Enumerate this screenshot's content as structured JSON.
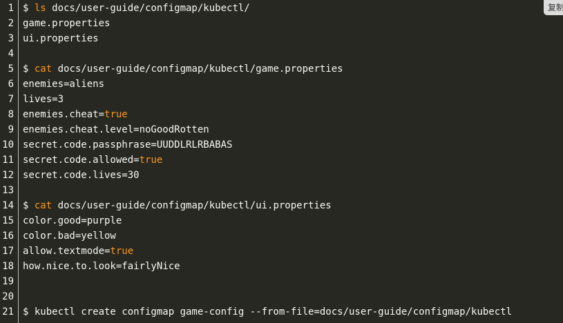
{
  "copy_button": {
    "label": "复制"
  },
  "lines": [
    {
      "n": "1",
      "segments": [
        {
          "text": "$ "
        },
        {
          "text": "ls",
          "kw": true
        },
        {
          "text": " docs/user-guide/configmap/kubectl/"
        }
      ]
    },
    {
      "n": "2",
      "segments": [
        {
          "text": "game.properties"
        }
      ]
    },
    {
      "n": "3",
      "segments": [
        {
          "text": "ui.properties"
        }
      ]
    },
    {
      "n": "4",
      "segments": []
    },
    {
      "n": "5",
      "segments": [
        {
          "text": "$ "
        },
        {
          "text": "cat",
          "kw": true
        },
        {
          "text": " docs/user-guide/configmap/kubectl/game.properties"
        }
      ]
    },
    {
      "n": "6",
      "segments": [
        {
          "text": "enemies=aliens"
        }
      ]
    },
    {
      "n": "7",
      "segments": [
        {
          "text": "lives=3"
        }
      ]
    },
    {
      "n": "8",
      "segments": [
        {
          "text": "enemies.cheat="
        },
        {
          "text": "true",
          "kw": true
        }
      ]
    },
    {
      "n": "9",
      "segments": [
        {
          "text": "enemies.cheat.level=noGoodRotten"
        }
      ]
    },
    {
      "n": "10",
      "segments": [
        {
          "text": "secret.code.passphrase=UUDDLRLRBABAS"
        }
      ]
    },
    {
      "n": "11",
      "segments": [
        {
          "text": "secret.code.allowed="
        },
        {
          "text": "true",
          "kw": true
        }
      ]
    },
    {
      "n": "12",
      "segments": [
        {
          "text": "secret.code.lives=30"
        }
      ]
    },
    {
      "n": "13",
      "segments": []
    },
    {
      "n": "14",
      "segments": [
        {
          "text": "$ "
        },
        {
          "text": "cat",
          "kw": true
        },
        {
          "text": " docs/user-guide/configmap/kubectl/ui.properties"
        }
      ]
    },
    {
      "n": "15",
      "segments": [
        {
          "text": "color.good=purple"
        }
      ]
    },
    {
      "n": "16",
      "segments": [
        {
          "text": "color.bad=yellow"
        }
      ]
    },
    {
      "n": "17",
      "segments": [
        {
          "text": "allow.textmode="
        },
        {
          "text": "true",
          "kw": true
        }
      ]
    },
    {
      "n": "18",
      "segments": [
        {
          "text": "how.nice.to.look=fairlyNice"
        }
      ]
    },
    {
      "n": "19",
      "segments": []
    },
    {
      "n": "20",
      "segments": []
    },
    {
      "n": "21",
      "segments": [
        {
          "text": "$ kubectl create configmap game-config --from-file=docs/user-guide/configmap/kubectl"
        }
      ]
    }
  ]
}
